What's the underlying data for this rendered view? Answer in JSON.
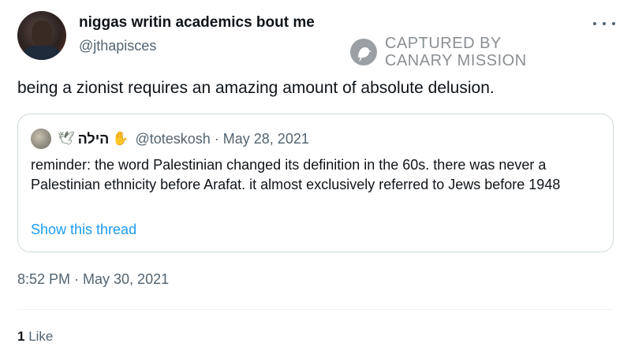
{
  "author": {
    "display_name": "niggas writin academics bout me",
    "handle": "@jthapisces"
  },
  "watermark": {
    "line1": "CAPTURED BY",
    "line2": "CANARY MISSION"
  },
  "tweet_text": "being a zionist requires an amazing amount of absolute delusion.",
  "quoted": {
    "display_name": "הילה",
    "handle_and_date": "@toteskosh · May 28, 2021",
    "text": "reminder: the word Palestinian changed its definition in the 60s. there was never a Palestinian ethnicity before Arafat. it almost exclusively referred to Jews before 1948",
    "show_thread": "Show this thread",
    "emoji_before": "dove-olive-branch-icon",
    "emoji_after": "hamsa-icon"
  },
  "timestamp": "8:52 PM · May 30, 2021",
  "likes": {
    "count": "1",
    "label": "Like"
  },
  "icons": {
    "more": "more-options-icon",
    "watermark_logo": "canary-bird-icon"
  },
  "colors": {
    "link": "#1d9bf0",
    "secondary_text": "#536471",
    "border": "#cfd9de"
  }
}
